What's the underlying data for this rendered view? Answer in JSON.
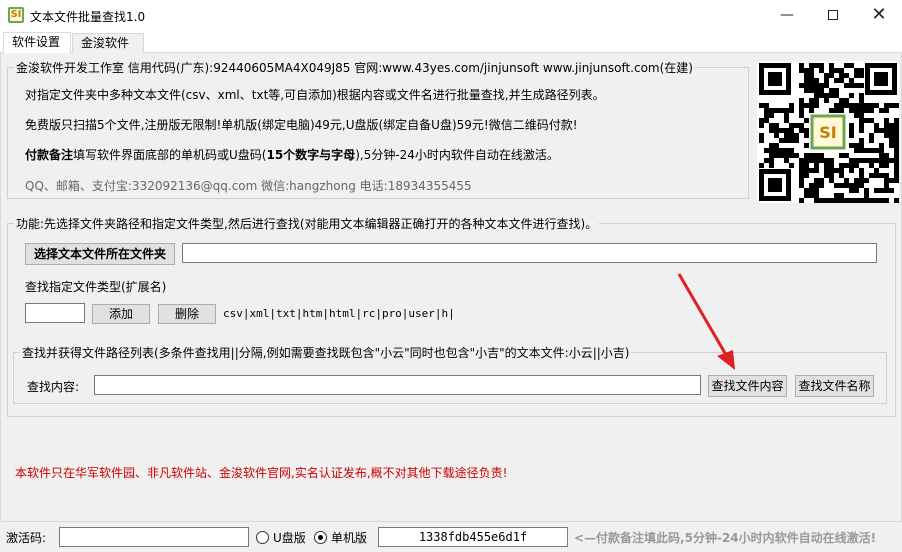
{
  "window": {
    "title": "文本文件批量查找1.0",
    "icon_label": "SI",
    "minimize_label": "—",
    "close_label": "✕"
  },
  "tabs": [
    {
      "label": "软件设置",
      "active": true
    },
    {
      "label": "金浚软件",
      "active": false
    }
  ],
  "info": {
    "legend": "金浚软件开发工作室 信用代码(广东):92440605MA4X049J85 官网:www.43yes.com/jinjunsoft  www.jinjunsoft.com(在建)",
    "line1": "对指定文件夹中多种文本文件(csv、xml、txt等,可自添加)根据内容或文件名进行批量查找,并生成路径列表。",
    "line2": "免费版只扫描5个文件,注册版无限制!单机版(绑定电脑)49元,U盘版(绑定自备U盘)59元!微信二维码付款!",
    "line3_bold": "付款备注",
    "line3_mid": "填写软件界面底部的单机码或U盘码(",
    "line3_bold2": "15个数字与字母",
    "line3_end": "),5分钟-24小时内软件自动在线激活。",
    "contact": "QQ、邮箱、支付宝:332092136@qq.com    微信:hangzhong    电话:18934355455"
  },
  "qr": {
    "center_label": "SI"
  },
  "function": {
    "legend": "功能:先选择文件夹路径和指定文件类型,然后进行查找(对能用文本编辑器正确打开的各种文本文件进行查找)。",
    "select_folder_button": "选择文本文件所在文件夹",
    "folder_path_value": "",
    "ext_label": "查找指定文件类型(扩展名)",
    "ext_input_value": "",
    "add_button": "添加",
    "delete_button": "删除",
    "ext_list": "csv|xml|txt|htm|html|rc|pro|user|h|"
  },
  "search": {
    "legend": "查找并获得文件路径列表(多条件查找用||分隔,例如需要查找既包含\"小云\"同时也包含\"小吉\"的文本文件:小云||小吉)",
    "content_label": "查找内容:",
    "content_value": "",
    "find_content_button": "查找文件内容",
    "find_name_button": "查找文件名称"
  },
  "notice": "本软件只在华军软件园、非凡软件站、金浚软件官网,实名认证发布,概不对其他下载途径负责!",
  "status": {
    "activation_label": "激活码:",
    "activation_value": "",
    "usb_label": "U盘版",
    "standalone_label": "单机版",
    "selected": "standalone",
    "machine_code": "1338fdb455e6d1f",
    "hint": "<—付款备注填此码,5分钟-24小时内软件自动在线激活!"
  },
  "colors": {
    "notice_red": "#cc0000",
    "arrow_red": "#e02020",
    "window_bg": "#f0f0f0"
  }
}
